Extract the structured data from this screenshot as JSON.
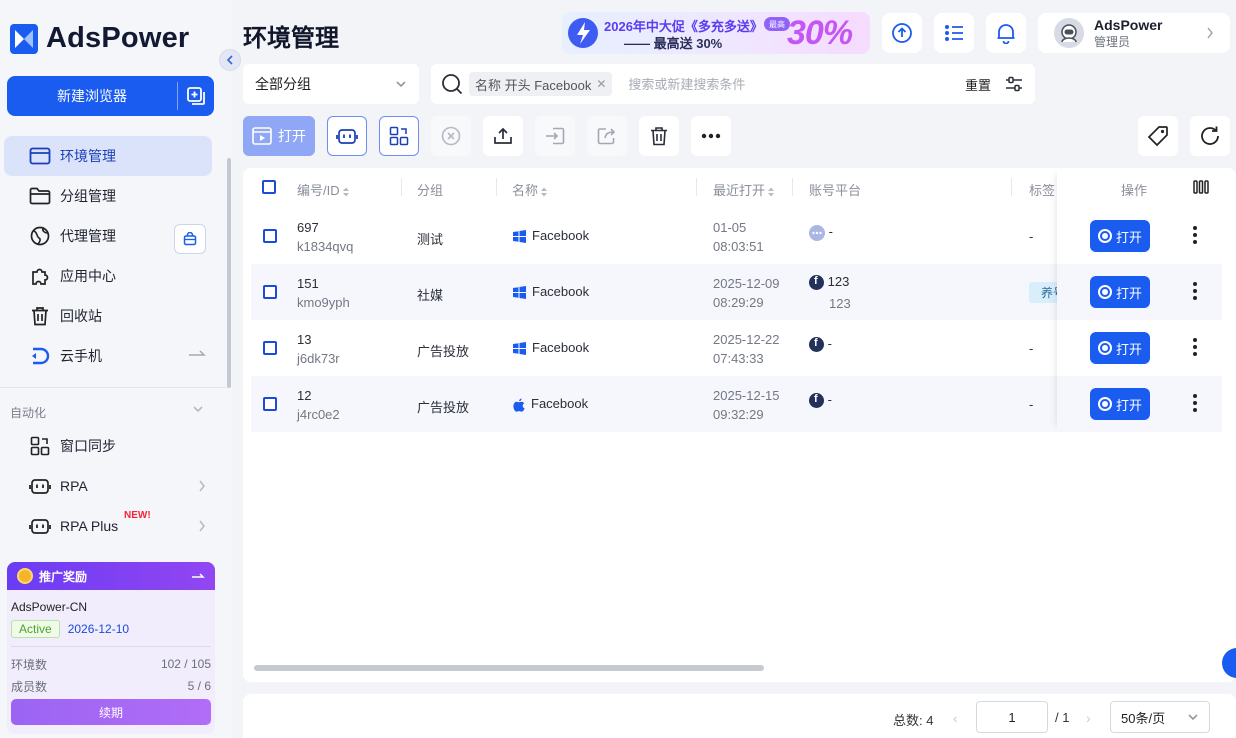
{
  "app": {
    "logo_text": "AdsPower"
  },
  "sidebar": {
    "new_browser_label": "新建浏览器",
    "items": [
      {
        "label": "环境管理",
        "icon": "browser-window-icon",
        "active": true
      },
      {
        "label": "分组管理",
        "icon": "folder-icon"
      },
      {
        "label": "代理管理",
        "icon": "globe-icon"
      },
      {
        "label": "应用中心",
        "icon": "puzzle-icon"
      },
      {
        "label": "回收站",
        "icon": "trash-icon"
      },
      {
        "label": "云手机",
        "icon": "cloud-phone-icon"
      }
    ],
    "automation_label": "自动化",
    "automation_items": [
      {
        "label": "窗口同步",
        "icon": "window-sync-icon"
      },
      {
        "label": "RPA",
        "icon": "robot-icon"
      },
      {
        "label": "RPA Plus",
        "icon": "robot-icon",
        "badge": "NEW!"
      }
    ],
    "promo": {
      "title": "推广奖励",
      "account": "AdsPower-CN",
      "status": "Active",
      "expiry": "2026-12-10",
      "rows": [
        {
          "label": "环境数",
          "value": "102 / 105"
        },
        {
          "label": "成员数",
          "value": "5 / 6"
        }
      ],
      "renew_label": "续期"
    }
  },
  "header": {
    "title": "环境管理",
    "banner": {
      "line1": "2026年中大促《多充多送》",
      "line2": "—— 最高送 30%",
      "big": "30%",
      "pill": "最高"
    },
    "user": {
      "name": "AdsPower",
      "role": "管理员"
    }
  },
  "filter": {
    "group_value": "全部分组",
    "chip": "名称 开头 Facebook",
    "search_placeholder": "搜索或新建搜索条件",
    "reset_label": "重置"
  },
  "toolbar": {
    "open_label": "打开"
  },
  "table": {
    "columns": {
      "id": "编号/ID",
      "group": "分组",
      "name": "名称",
      "last_open": "最近打开",
      "platform": "账号平台",
      "tags": "标签",
      "actions": "操作"
    },
    "rows": [
      {
        "no": "697",
        "id": "k1834qvq",
        "group": "测试",
        "os": "windows",
        "name": "Facebook",
        "date": "01-05",
        "time": "08:03:51",
        "platform_icon": "ellipsis-icon",
        "platform": "-",
        "platform_sub": "",
        "tag": "-"
      },
      {
        "no": "151",
        "id": "kmo9yph",
        "group": "社媒",
        "os": "windows",
        "name": "Facebook",
        "date": "2025-12-09",
        "time": "08:29:29",
        "platform_icon": "facebook-icon",
        "platform": "123",
        "platform_sub": "123",
        "tag": "养号"
      },
      {
        "no": "13",
        "id": "j6dk73r",
        "group": "广告投放",
        "os": "windows",
        "name": "Facebook",
        "date": "2025-12-22",
        "time": "07:43:33",
        "platform_icon": "facebook-icon",
        "platform": "-",
        "platform_sub": "",
        "tag": "-"
      },
      {
        "no": "12",
        "id": "j4rc0e2",
        "group": "广告投放",
        "os": "apple",
        "name": "Facebook",
        "date": "2025-12-15",
        "time": "09:32:29",
        "platform_icon": "facebook-icon",
        "platform": "-",
        "platform_sub": "",
        "tag": "-"
      }
    ],
    "open_label": "打开"
  },
  "pagination": {
    "total_label": "总数: 4",
    "page": "1",
    "pages_label": "/ 1",
    "page_size": "50条/页"
  },
  "colors": {
    "primary": "#1a5bf0",
    "sidebar_active": "#dbe3fa",
    "promo": "#7b44f4"
  }
}
